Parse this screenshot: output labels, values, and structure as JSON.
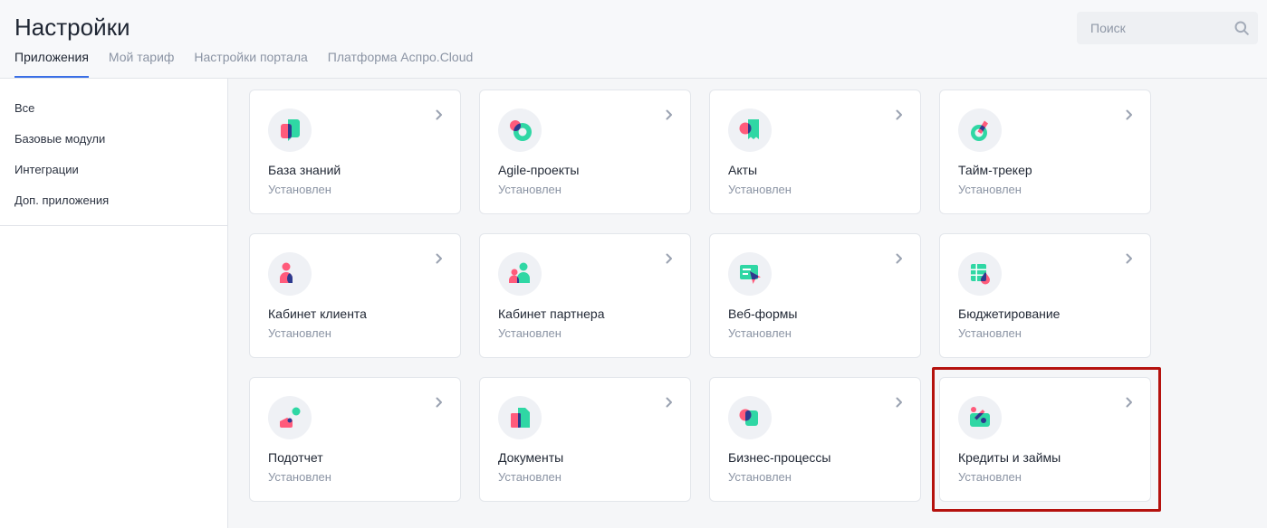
{
  "page": {
    "title": "Настройки"
  },
  "tabs": [
    {
      "label": "Приложения",
      "active": true
    },
    {
      "label": "Мой тариф",
      "active": false
    },
    {
      "label": "Настройки портала",
      "active": false
    },
    {
      "label": "Платформа Аспро.Cloud",
      "active": false
    }
  ],
  "search": {
    "placeholder": "Поиск",
    "value": "",
    "icon": "search-icon"
  },
  "sidebar": {
    "items": [
      {
        "label": "Все"
      },
      {
        "label": "Базовые модули"
      },
      {
        "label": "Интеграции"
      },
      {
        "label": "Доп. приложения"
      }
    ]
  },
  "chevron_icon": "chevron-right-icon",
  "apps": [
    {
      "name": "База знаний",
      "status": "Установлен",
      "icon": "knowledge-base-icon"
    },
    {
      "name": "Agile-проекты",
      "status": "Установлен",
      "icon": "agile-projects-icon"
    },
    {
      "name": "Акты",
      "status": "Установлен",
      "icon": "acts-icon"
    },
    {
      "name": "Тайм-трекер",
      "status": "Установлен",
      "icon": "time-tracker-icon"
    },
    {
      "name": "Кабинет клиента",
      "status": "Установлен",
      "icon": "client-cabinet-icon"
    },
    {
      "name": "Кабинет партнера",
      "status": "Установлен",
      "icon": "partner-cabinet-icon"
    },
    {
      "name": "Веб-формы",
      "status": "Установлен",
      "icon": "web-forms-icon"
    },
    {
      "name": "Бюджетирование",
      "status": "Установлен",
      "icon": "budgeting-icon"
    },
    {
      "name": "Подотчет",
      "status": "Установлен",
      "icon": "accountable-funds-icon"
    },
    {
      "name": "Документы",
      "status": "Установлен",
      "icon": "documents-icon"
    },
    {
      "name": "Бизнес-процессы",
      "status": "Установлен",
      "icon": "business-processes-icon"
    },
    {
      "name": "Кредиты и займы",
      "status": "Установлен",
      "icon": "credits-loans-icon",
      "highlighted": true
    }
  ],
  "colors": {
    "text": "#1f2633",
    "muted": "#8b94a4",
    "accent": "#3a6fe6",
    "teal": "#2fd7a4",
    "pink": "#ff5b7b",
    "navy": "#2d3a8e",
    "highlight": "#b5120e"
  }
}
